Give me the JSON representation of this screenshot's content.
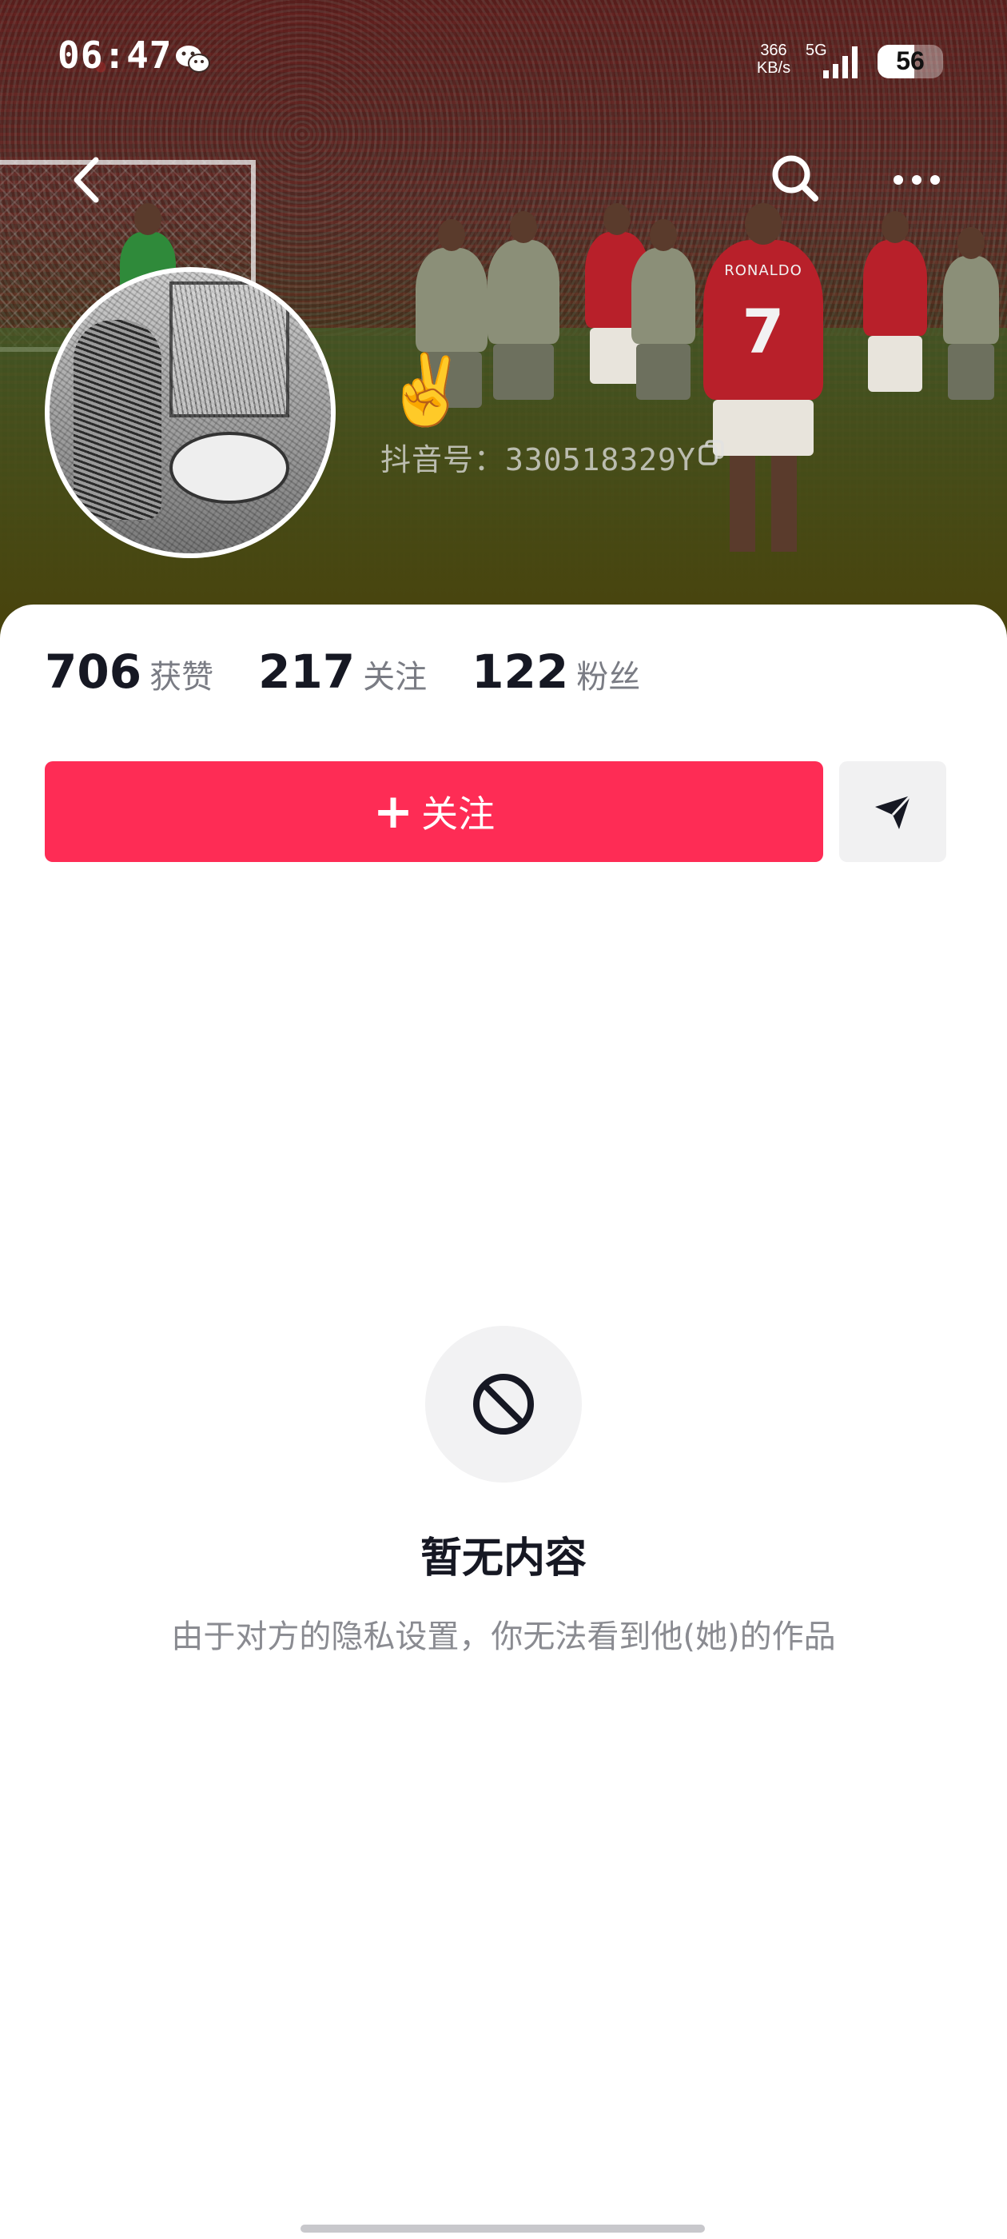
{
  "status_bar": {
    "time": "06:47",
    "net_speed_value": "366",
    "net_speed_unit": "KB/s",
    "network_type": "5G",
    "battery": "56",
    "battery_level": 0.56,
    "icons": [
      "wechat-icon",
      "signal-icon",
      "battery-icon"
    ]
  },
  "nav": {
    "icons": [
      "back-arrow-icon",
      "search-icon",
      "more-icon"
    ]
  },
  "profile": {
    "nickname": "✌️",
    "douyin_id": "抖音号：330518329Y",
    "cover": {
      "jersey_name": "RONALDO",
      "jersey_number": "7"
    }
  },
  "stats": [
    {
      "value": "706",
      "label": "获赞"
    },
    {
      "value": "217",
      "label": "关注"
    },
    {
      "value": "122",
      "label": "粉丝"
    }
  ],
  "actions": {
    "follow_plus": "+",
    "follow_label": "关注",
    "send_icon": "paper-plane-icon"
  },
  "empty_state": {
    "icon": "prohibited-icon",
    "title": "暂无内容",
    "description": "由于对方的隐私设置，你无法看到他(她)的作品"
  },
  "colors": {
    "accent": "#fe2c55",
    "text_primary": "#161823",
    "text_secondary": "#8a8b91"
  }
}
